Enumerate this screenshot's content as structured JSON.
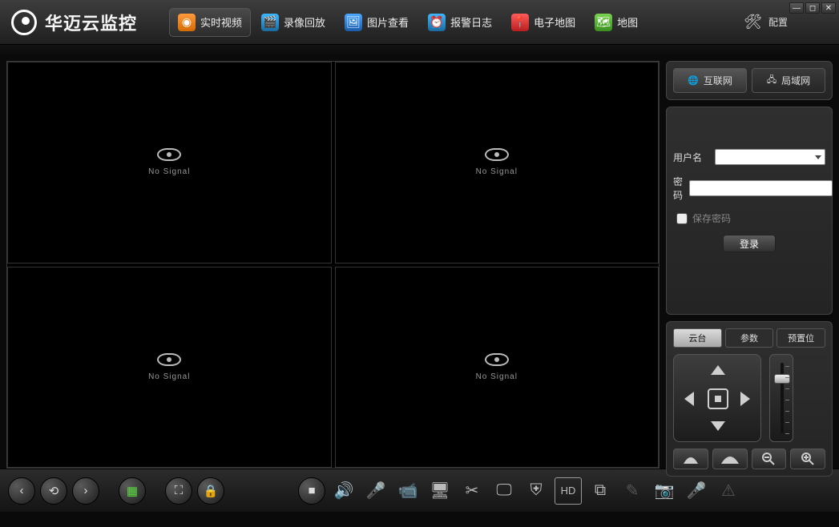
{
  "app": {
    "title": "华迈云监控"
  },
  "nav": [
    {
      "label": "实时视频",
      "icon": "camera-icon",
      "cls": "ic-orange",
      "active": true
    },
    {
      "label": "录像回放",
      "icon": "film-icon",
      "cls": "ic-teal",
      "active": false
    },
    {
      "label": "图片查看",
      "icon": "image-icon",
      "cls": "ic-blue",
      "active": false
    },
    {
      "label": "报警日志",
      "icon": "alarm-icon",
      "cls": "ic-teal",
      "active": false
    },
    {
      "label": "电子地图",
      "icon": "map-pin-icon",
      "cls": "ic-red",
      "active": false
    },
    {
      "label": "地图",
      "icon": "map-icon",
      "cls": "ic-green",
      "active": false
    }
  ],
  "config_label": "配置",
  "window": {
    "min": "—",
    "max": "◻",
    "close": "✕"
  },
  "video": {
    "no_signal": "No Signal"
  },
  "side": {
    "net_tabs": {
      "internet": "互联网",
      "lan": "局域网"
    },
    "login": {
      "user_label": "用户名",
      "pass_label": "密码",
      "save_pw": "保存密码",
      "login_btn": "登录",
      "user_value": "",
      "pass_value": ""
    },
    "ptz_tabs": {
      "ptz": "云台",
      "params": "参数",
      "preset": "预置位"
    },
    "img_btns": {
      "near": "▲",
      "far": "▲",
      "zoom_out": "⊖",
      "zoom_in": "⊕"
    }
  },
  "bottom": {
    "prev": "‹",
    "refresh": "⟲",
    "next": "›",
    "grid": "▦",
    "full": "⛶",
    "lock": "🔒",
    "stop": "■",
    "vol": "🔊",
    "mic": "🎤",
    "rec": "📹",
    "dev": "🖥",
    "cut": "✂",
    "screen": "🖵",
    "shield": "⛨",
    "hd": "HD",
    "cast": "⧉",
    "edit": "✎",
    "cam2": "📷",
    "mic2": "🎤",
    "alert": "⚠"
  }
}
